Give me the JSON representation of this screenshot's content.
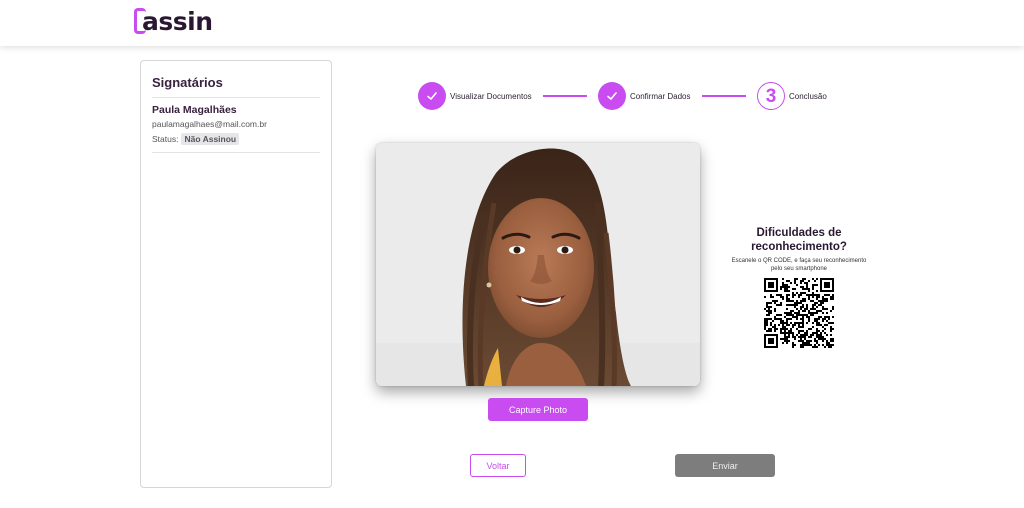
{
  "header": {
    "logo_text": "assin"
  },
  "sidebar": {
    "title": "Signatários",
    "signer": {
      "name": "Paula Magalhães",
      "email": "paulamagalhaes@mail.com.br",
      "status_label": "Status:",
      "status_value": "Não Assinou"
    }
  },
  "stepper": {
    "steps": [
      {
        "label": "Visualizar Documentos",
        "state": "done",
        "icon": "check-icon"
      },
      {
        "label": "Confirmar Dados",
        "state": "done",
        "icon": "check-icon"
      },
      {
        "label": "Conclusão",
        "state": "current",
        "number": "3"
      }
    ]
  },
  "camera": {
    "capture_label": "Capture Photo"
  },
  "qr": {
    "title": "Dificuldades de reconhecimento?",
    "subtitle": "Escanele o QR CODE, e faça seu reconhecimento pelo seu smartphone"
  },
  "actions": {
    "back_label": "Voltar",
    "send_label": "Enviar"
  },
  "colors": {
    "accent": "#c84cf0",
    "disabled": "#7d7d7d",
    "text_dark": "#2a1832"
  }
}
